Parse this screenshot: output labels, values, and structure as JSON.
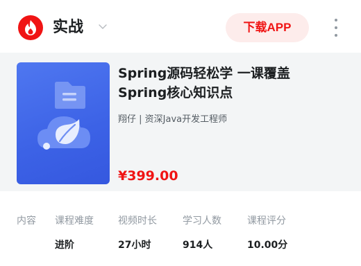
{
  "header": {
    "brand_label": "实战",
    "download_label": "下载APP"
  },
  "course": {
    "title_line1": "Spring源码轻松学 一课覆盖",
    "title_line2": "Spring核心知识点",
    "teacher": "翔仔 | 资深Java开发工程师",
    "price": "¥399.00"
  },
  "stats": {
    "tab_label": "内容",
    "items": [
      {
        "label": "课程难度",
        "value": "进阶"
      },
      {
        "label": "视频时长",
        "value": "27小时"
      },
      {
        "label": "学习人数",
        "value": "914人"
      },
      {
        "label": "课程评分",
        "value": "10.00分"
      }
    ]
  },
  "colors": {
    "brand_red": "#f01414",
    "download_bg": "#fdeceb",
    "cover_blue": "#3c62e6",
    "card_bg": "#f3f5f6"
  },
  "icons": [
    "flame-logo-icon",
    "chevron-down-icon",
    "more-vertical-icon",
    "folder-icon",
    "cloud-leaf-icon"
  ]
}
